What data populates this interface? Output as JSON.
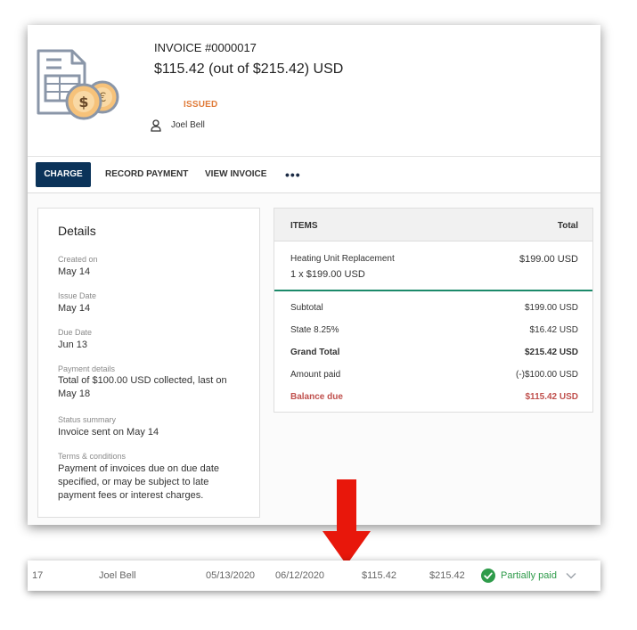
{
  "invoice": {
    "number": "INVOICE #0000017",
    "amount_line": "$115.42 (out of $215.42) USD",
    "status": "ISSUED",
    "customer": "Joel Bell",
    "icons": {
      "illustration": "invoice-coins-icon",
      "customer": "person-icon"
    }
  },
  "tabs": {
    "charge": "CHARGE",
    "record_payment": "RECORD PAYMENT",
    "view_invoice": "VIEW INVOICE",
    "more": "•••"
  },
  "details": {
    "title": "Details",
    "created_label": "Created on",
    "created_value": "May 14",
    "issue_label": "Issue Date",
    "issue_value": "May 14",
    "due_label": "Due Date",
    "due_value": "Jun 13",
    "payment_label": "Payment details",
    "payment_value": "Total of $100.00 USD collected, last on May 18",
    "status_label": "Status summary",
    "status_value": "Invoice sent on May 14",
    "terms_label": "Terms & conditions",
    "terms_value": "Payment of invoices due on due date specified, or may be subject to late payment fees or interest charges."
  },
  "items": {
    "header_items": "ITEMS",
    "header_total": "Total",
    "line": {
      "name": "Heating Unit Replacement",
      "qty": "1 x $199.00 USD",
      "total": "$199.00 USD"
    },
    "summary": [
      {
        "label": "Subtotal",
        "value": "$199.00 USD"
      },
      {
        "label": "State 8.25%",
        "value": "$16.42 USD"
      },
      {
        "label": "Grand Total",
        "value": "$215.42 USD"
      },
      {
        "label": "Amount paid",
        "value": "(-)$100.00 USD"
      },
      {
        "label": "Balance due",
        "value": "$115.42 USD"
      }
    ]
  },
  "list_row": {
    "number": "17",
    "customer": "Joel Bell",
    "date": "05/13/2020",
    "due": "06/12/2020",
    "balance": "$115.42",
    "total": "$215.42",
    "status": "Partially paid",
    "status_color": "#2e9b4a"
  },
  "colors": {
    "accent": "#0b3359",
    "status_issued": "#e07b39",
    "balance_due": "#c0504d",
    "divider": "#1c8a6a",
    "arrow": "#e8170b"
  }
}
